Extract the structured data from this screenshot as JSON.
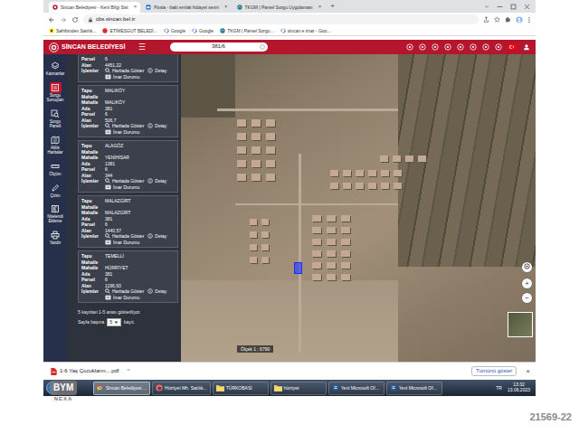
{
  "browser": {
    "tabs": [
      {
        "label": "Sincan Belediyesi - Kent Bilgi Sist",
        "close": "×",
        "selected": true,
        "kind": "sincan"
      },
      {
        "label": "Posta - baki emlak hidayet sevin",
        "close": "×",
        "selected": false,
        "kind": "mail"
      },
      {
        "label": "TKGM | Parsel Sorgu Uygulaması",
        "close": "×",
        "selected": false,
        "kind": "tkgm"
      }
    ],
    "new_tab": "+",
    "address": "cbs.sincan.bel.tr",
    "bookmarks": [
      {
        "label": "Sahibinden Satılık...",
        "kind": "sahibinden"
      },
      {
        "label": "ETİMESGUT BELEDİ...",
        "kind": "site"
      },
      {
        "label": "Google",
        "kind": "google"
      },
      {
        "label": "Google",
        "kind": "google"
      },
      {
        "label": "TKGM | Parsel Sorgu...",
        "kind": "tkgm"
      },
      {
        "label": "sincan e imar - Goo...",
        "kind": "google"
      }
    ]
  },
  "app": {
    "logo": "SİNCAN BELEDİYESİ",
    "menu": "☰",
    "search": "381/6",
    "sidebar": [
      {
        "label": "Katmanlar",
        "kind": "layers",
        "selected": false
      },
      {
        "label": "Sorgu Sonuçları",
        "kind": "results",
        "selected": true
      },
      {
        "label": "Sorgu Paneli",
        "kind": "query",
        "selected": false
      },
      {
        "label": "Altlık Haritalar",
        "kind": "basemap",
        "selected": false
      },
      {
        "label": "Ölçüm",
        "kind": "measure",
        "selected": false
      },
      {
        "label": "Çizim",
        "kind": "draw",
        "selected": false
      },
      {
        "label": "Nitelendi Ekleme",
        "kind": "note",
        "selected": false
      },
      {
        "label": "Yazdır",
        "kind": "print",
        "selected": false
      }
    ],
    "results": {
      "cards": [
        {
          "fields": [
            {
              "label": "Parsel",
              "value": "6"
            },
            {
              "label": "Alan",
              "value": "4451,22"
            }
          ],
          "actions_label": "İşlemler",
          "actions": [
            {
              "label": "Haritada Göster",
              "kind": "map"
            },
            {
              "label": "Detay",
              "kind": "info"
            },
            {
              "label": "İmar Durumu",
              "kind": "zoning"
            }
          ]
        },
        {
          "fields": [
            {
              "label": "Tapu Mahalle",
              "value": "MALIKÖY"
            },
            {
              "label": "Mahalle",
              "value": "MALIKÖY"
            },
            {
              "label": "Ada",
              "value": "381"
            },
            {
              "label": "Parsel",
              "value": "6"
            },
            {
              "label": "Alan",
              "value": "506,7"
            }
          ],
          "actions_label": "İşlemler",
          "actions": [
            {
              "label": "Haritada Göster",
              "kind": "map"
            },
            {
              "label": "Detay",
              "kind": "info"
            },
            {
              "label": "İmar Durumu",
              "kind": "zoning"
            }
          ]
        },
        {
          "fields": [
            {
              "label": "Tapu Mahalle",
              "value": "ALAGÖZ"
            },
            {
              "label": "Mahalle",
              "value": "YENİHİSAR"
            },
            {
              "label": "Ada",
              "value": "1381"
            },
            {
              "label": "Parsel",
              "value": "6"
            },
            {
              "label": "Alan",
              "value": "344"
            }
          ],
          "actions_label": "İşlemler",
          "actions": [
            {
              "label": "Haritada Göster",
              "kind": "map"
            },
            {
              "label": "Detay",
              "kind": "info"
            },
            {
              "label": "İmar Durumu",
              "kind": "zoning"
            }
          ]
        },
        {
          "fields": [
            {
              "label": "Tapu Mahalle",
              "value": "MALAZGİRT"
            },
            {
              "label": "Mahalle",
              "value": "MALAZGİRT"
            },
            {
              "label": "Ada",
              "value": "381"
            },
            {
              "label": "Parsel",
              "value": "6"
            },
            {
              "label": "Alan",
              "value": "1440,57"
            }
          ],
          "actions_label": "İşlemler",
          "actions": [
            {
              "label": "Haritada Göster",
              "kind": "map"
            },
            {
              "label": "Detay",
              "kind": "info"
            },
            {
              "label": "İmar Durumu",
              "kind": "zoning"
            }
          ]
        },
        {
          "fields": [
            {
              "label": "Tapu Mahalle",
              "value": "TEMELLİ"
            },
            {
              "label": "Mahalle",
              "value": "HÜRRİYET"
            },
            {
              "label": "Ada",
              "value": "381"
            },
            {
              "label": "Parsel",
              "value": "6"
            },
            {
              "label": "Alan",
              "value": "1196,93"
            }
          ],
          "actions_label": "İşlemler",
          "actions": [
            {
              "label": "Haritada Göster",
              "kind": "map"
            },
            {
              "label": "Detay",
              "kind": "info"
            },
            {
              "label": "İmar Durumu",
              "kind": "zoning"
            }
          ]
        }
      ],
      "summary": "5 kayıttan 1-5 arası gösteriliyor.",
      "per_page_label": "Sayfa başına",
      "per_page": "5",
      "per_page_suffix": "kayıt."
    },
    "map": {
      "scale": "Ölçek 1 : 6790",
      "zoom_in": "+",
      "zoom_out": "−"
    }
  },
  "download": {
    "file": "1-6 Yaş Çocukların....pdf",
    "caret": "^",
    "show_all": "Tümünü göster",
    "close": "×"
  },
  "taskbar": {
    "items": [
      {
        "label": "Sincan Belediyesi ...",
        "kind": "chrome",
        "selected": true
      },
      {
        "label": "Hürriyet Mh. Satılık...",
        "kind": "firefox",
        "selected": false
      },
      {
        "label": "TÜRKOBASI",
        "kind": "folder",
        "selected": false
      },
      {
        "label": "hürriyet",
        "kind": "folder",
        "selected": false
      },
      {
        "label": "Yeni Microsoft Of...",
        "kind": "word",
        "selected": false
      },
      {
        "label": "Yeni Microsoft Of...",
        "kind": "word",
        "selected": false
      }
    ],
    "lang": "TR",
    "time": "13:32",
    "date": "13.06.2023"
  },
  "watermark": {
    "brand": "BYM",
    "name": "NEXA",
    "code": "21569-22"
  }
}
